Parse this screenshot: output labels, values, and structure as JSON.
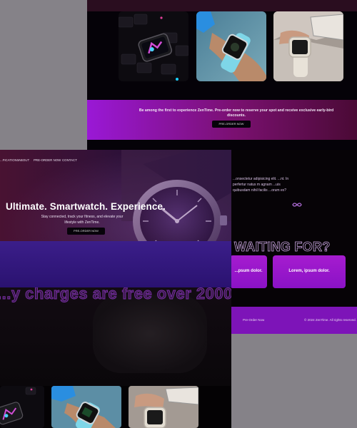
{
  "back_page": {
    "banner": {
      "text": "Be among the first to experience ZenTime. Pre-order now to reserve your spot and receive exclusive early-bird discounts.",
      "button_label": "PRE-ORDER NOW"
    },
    "features": {
      "text": "...onsectetur adipisicing elit. ...nt. In perfertur natus m agnam ...uis quibusdam nihil facilis ...orum ex?"
    },
    "heading": "WAITING FOR?",
    "cards": [
      {
        "label": "...psum dolor."
      },
      {
        "label": "Lorem, ipsum dolor."
      }
    ],
    "footer": {
      "link": "Pre-Order Now",
      "copyright": "© 2024 ZenTime. All rights reserved."
    }
  },
  "front_page": {
    "nav": [
      "...FICATIONS",
      "ABOUT",
      "PRE-ORDER NOW",
      "CONTACT"
    ],
    "hero": {
      "title": "Ultimate. Smartwatch. Experience.",
      "subtitle": "Stay connected, track your fitness, and elevate your lifestyle with ZenTime.",
      "button_label": "PRE-ORDER NOW"
    },
    "marquee": "...y charges are free over 2000"
  },
  "colors": {
    "accent_purple": "#9a18d6",
    "dark_bg": "#050208",
    "gray_bg": "#858288"
  }
}
